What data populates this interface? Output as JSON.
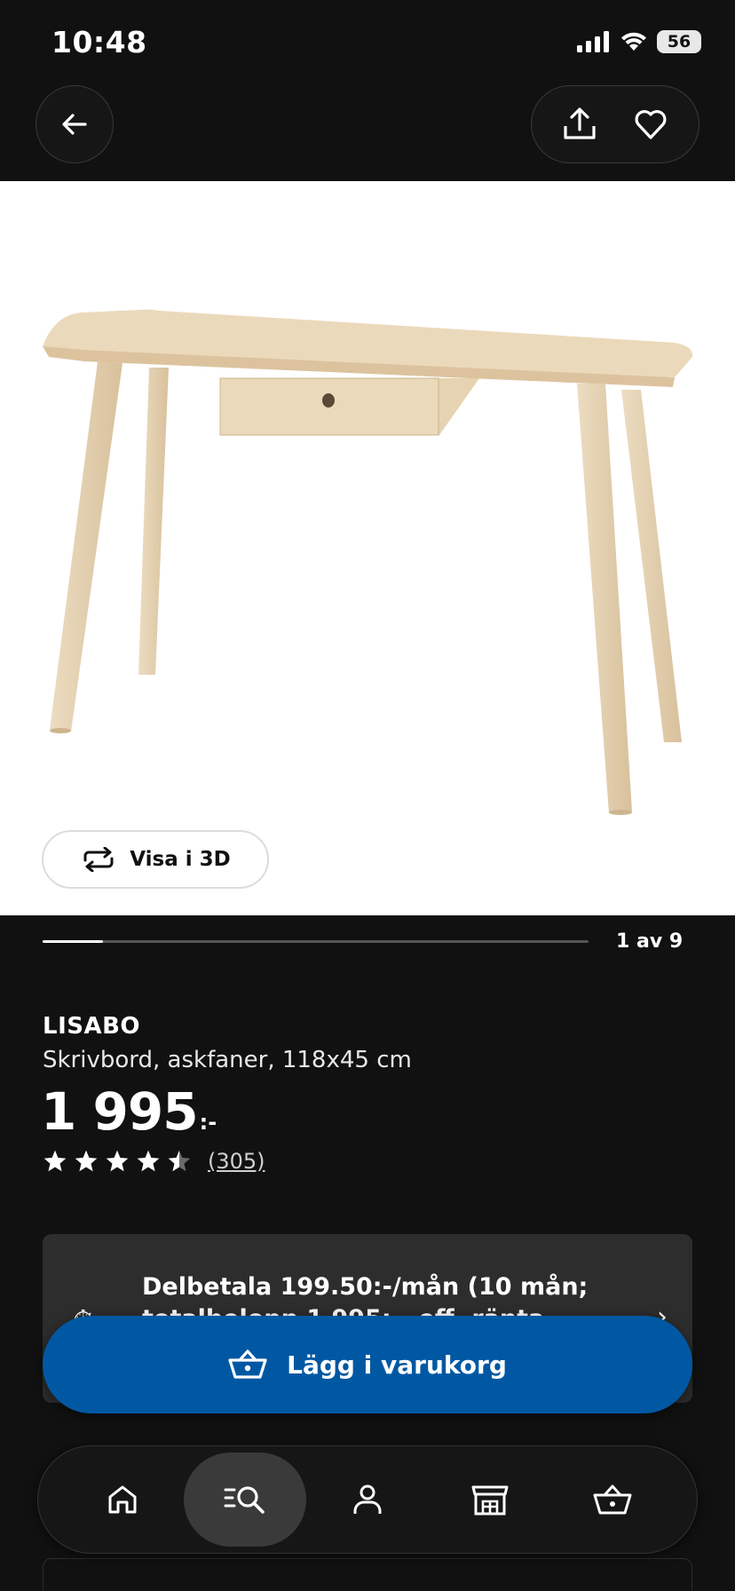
{
  "status_bar": {
    "time": "10:48",
    "battery": "56"
  },
  "header": {
    "icons": {
      "back": "arrow-left-icon",
      "share": "share-icon",
      "favorite": "heart-icon"
    }
  },
  "gallery": {
    "view_3d_label": "Visa i 3D",
    "counter": "1 av 9",
    "current_image": 1,
    "total_images": 9
  },
  "product": {
    "name": "LISABO",
    "description": "Skrivbord, askfaner, 118x45 cm",
    "price": "1 995",
    "price_suffix": ":-",
    "rating": 4.5,
    "rating_max": 5,
    "review_count": "(305)"
  },
  "installment": {
    "line1": "Delbetala 199.50:-/mån (10 mån;",
    "line2": "totalbelopp 1 995:-, eff. ränta 0%)"
  },
  "cta": {
    "add_to_cart_label": "Lägg i varukorg"
  },
  "bottom_nav": {
    "items": [
      {
        "icon": "home-icon",
        "active": false
      },
      {
        "icon": "search-icon",
        "active": true
      },
      {
        "icon": "profile-icon",
        "active": false
      },
      {
        "icon": "store-icon",
        "active": false
      },
      {
        "icon": "cart-icon",
        "active": false
      }
    ]
  },
  "colors": {
    "accent": "#0058a3",
    "background": "#111111",
    "card": "#2d2d2d"
  }
}
